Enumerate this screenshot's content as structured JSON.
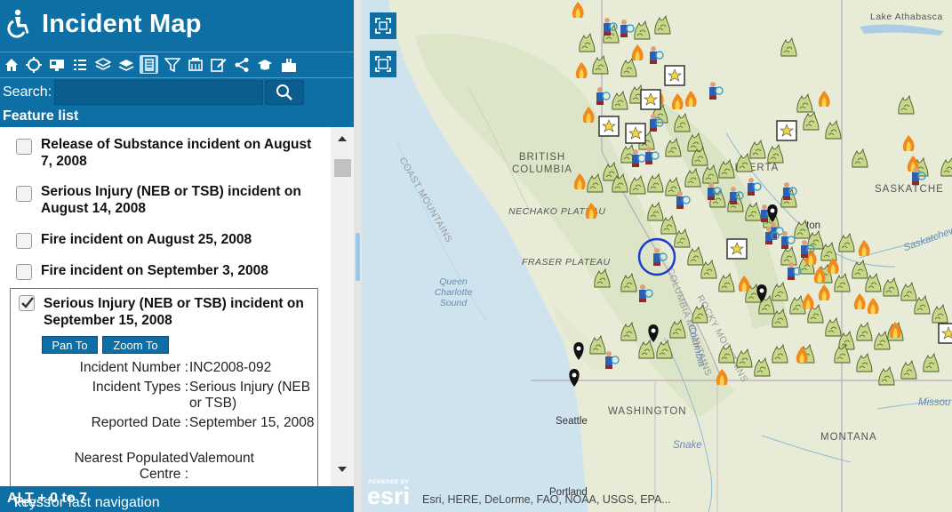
{
  "app": {
    "title": "Incident Map"
  },
  "toolbar": {
    "tools": [
      "home-icon",
      "locate-icon",
      "basemap-icon",
      "legend-icon",
      "layers-icon",
      "layer-list-icon",
      "feature-list-icon",
      "filter-icon",
      "print-icon",
      "edit-icon",
      "share-icon",
      "about-icon",
      "export-icon"
    ]
  },
  "search": {
    "label": "Search:",
    "placeholder": "",
    "value": ""
  },
  "feature_list": {
    "heading": "Feature list",
    "items": [
      {
        "title": "Release of Substance incident on August 7, 2008"
      },
      {
        "title": "Serious Injury (NEB or TSB) incident on August 14, 2008"
      },
      {
        "title": "Fire incident on August 25, 2008"
      },
      {
        "title": "Fire incident on September 3, 2008"
      },
      {
        "title": "Serious Injury (NEB or TSB) incident on September 15, 2008"
      }
    ],
    "expanded": {
      "pan_label": "Pan To",
      "zoom_label": "Zoom To",
      "fields": [
        {
          "key": "Incident Number :",
          "value": "INC2008-092"
        },
        {
          "key": "Incident Types :",
          "value": "Serious Injury (NEB or TSB)"
        },
        {
          "key": "Reported Date :",
          "value": "September 15, 2008"
        },
        {
          "key": "Nearest Populated Centre :",
          "value": "Valemount"
        }
      ]
    }
  },
  "footer": {
    "pre": "Press ",
    "keys": "ALT + 0 to 7",
    "post": " keys for fast navigation"
  },
  "map": {
    "attribution": "Esri, HERE, DeLorme, FAO, NOAA, USGS, EPA...",
    "powered_by": "POWERED BY",
    "esri": "esri",
    "labels": {
      "lake_athabasca": "Lake Athabasca",
      "british_columbia": "BRITISH COLUMBIA",
      "alberta": "ALBERTA",
      "saskatchewan": "SASKATCHE",
      "nechako": "NECHAKO PLATEAU",
      "fraser": "FRASER PLATEAU",
      "queen_charlotte": "Queen Charlotte Sound",
      "coast_mountains": "COAST MOUNTAINS",
      "columbia_mountains": "COLUMBIA MOUNTAINS",
      "rocky_mountains": "ROCKY MOUNTAINS",
      "washington": "WASHINGTON",
      "montana": "MONTANA",
      "seattle": "Seattle",
      "portland": "Portland",
      "snake": "Snake",
      "missouri": "Missou",
      "saskatchewan_river": "Saskatchewa",
      "columbia_river": "Columbia",
      "edmonton_fragment": "ton"
    }
  },
  "colors": {
    "primary": "#0e6fa5",
    "dark": "#0b5d8d",
    "selected_ring": "#1b3fcc"
  }
}
